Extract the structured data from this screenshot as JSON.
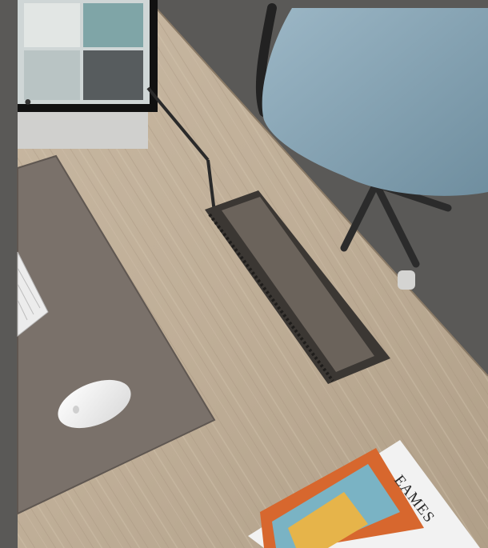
{
  "photo": {
    "magazine": {
      "title": "EAMES"
    }
  }
}
